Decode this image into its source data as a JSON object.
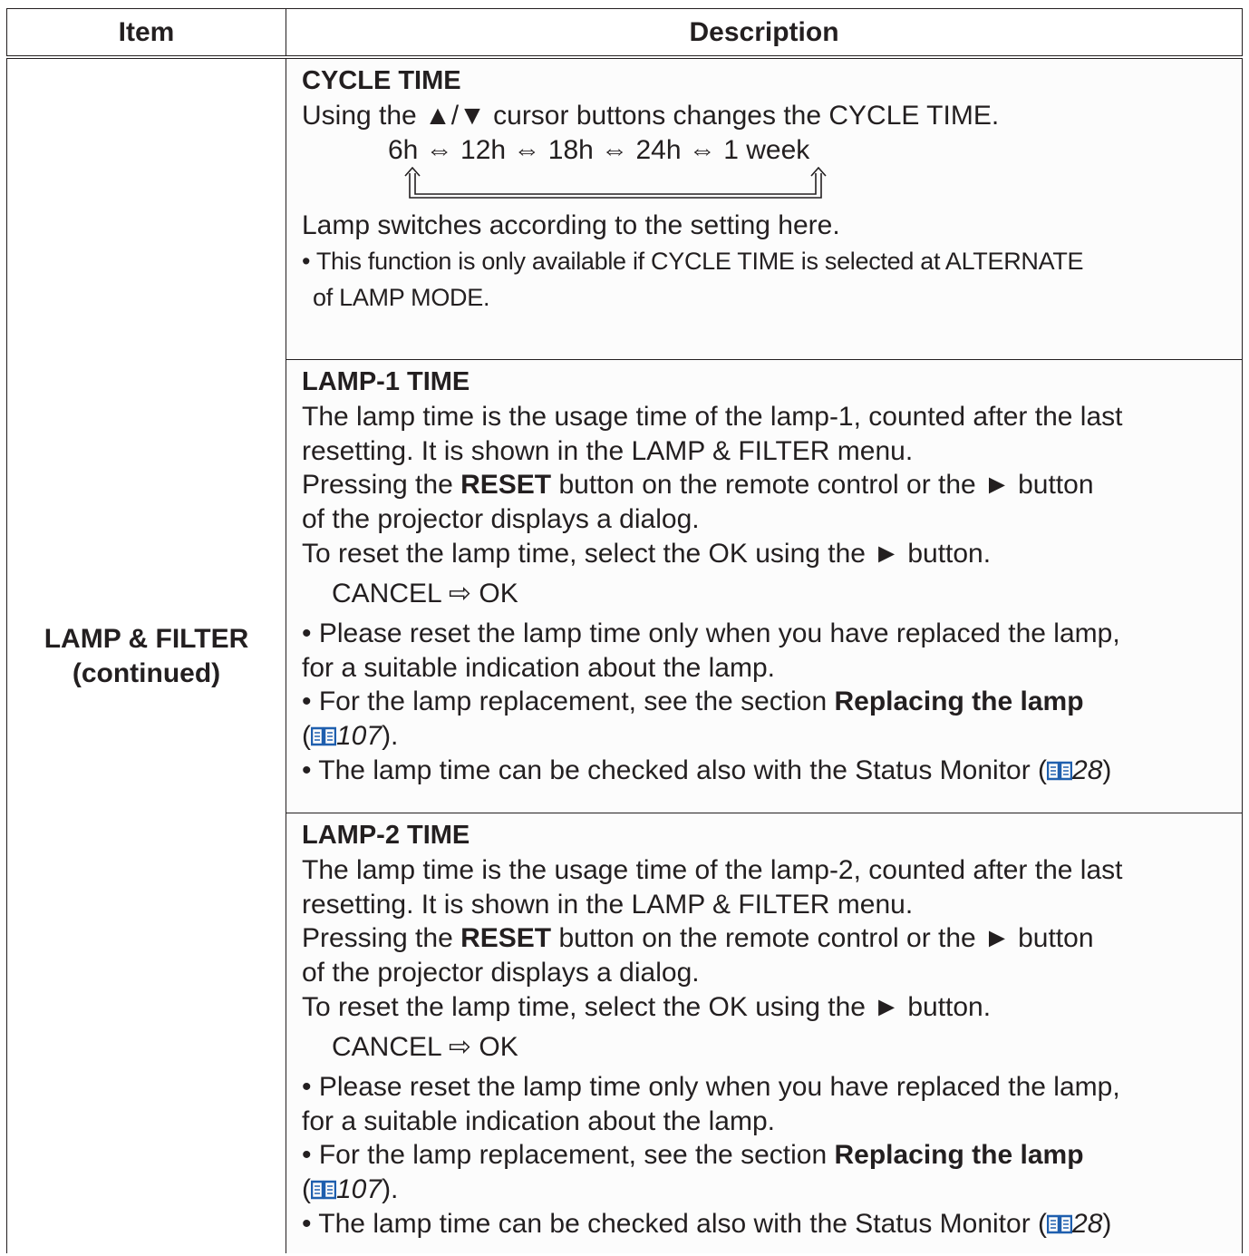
{
  "header": {
    "item": "Item",
    "description": "Description"
  },
  "item_label": {
    "line1": "LAMP & FILTER",
    "line2": "(continued)"
  },
  "cycle_time": {
    "title": "CYCLE TIME",
    "line1": "Using the ▲/▼ cursor buttons changes the CYCLE TIME.",
    "sequence": "6h ⇔ 12h ⇔ 18h ⇔ 24h ⇔ 1 week",
    "line2": "Lamp switches according to the setting here.",
    "note1": "• This function is only available if CYCLE TIME is selected at ALTERNATE",
    "note2": "of LAMP MODE."
  },
  "lamp1": {
    "title": "LAMP-1 TIME",
    "l1": "The lamp time is the usage time of the lamp-1, counted after the last",
    "l2": "resetting. It is shown in the LAMP & FILTER menu.",
    "l3_a": "Pressing the ",
    "l3_b": "RESET",
    "l3_c": " button on the remote control or the ► button",
    "l4": "of the projector displays a dialog.",
    "l5": "To reset the lamp time, select the OK using the ► button.",
    "dialog": "CANCEL ⇨ OK",
    "b1a": "• Please reset the lamp time only when you have replaced the lamp,",
    "b1b": "for a suitable indication about the lamp.",
    "b2a": "• For the lamp replacement, see the section ",
    "b2b": "Replacing the lamp",
    "b2c_open": "(",
    "b2c_ref": "107",
    "b2c_close": ").",
    "b3a": "• The lamp time can be checked also with the Status Monitor (",
    "b3_ref": "28",
    "b3_close": ")"
  },
  "lamp2": {
    "title": "LAMP-2 TIME",
    "l1": "The lamp time is the usage time of the lamp-2, counted after the last",
    "l2": "resetting. It is shown in the LAMP & FILTER menu.",
    "l3_a": "Pressing the ",
    "l3_b": "RESET",
    "l3_c": " button on the remote control or the ► button",
    "l4": "of the projector displays a dialog.",
    "l5": "To reset the lamp time, select the OK using the ► button.",
    "dialog": "CANCEL ⇨ OK",
    "b1a": "• Please reset the lamp time only when you have replaced the lamp,",
    "b1b": "for a suitable indication about the lamp.",
    "b2a": "• For the lamp replacement, see the section ",
    "b2b": "Replacing the lamp",
    "b2c_open": "(",
    "b2c_ref": "107",
    "b2c_close": ").",
    "b3a": "• The lamp time can be checked also with the Status Monitor (",
    "b3_ref": "28",
    "b3_close": ")"
  },
  "icons": {
    "reference": "book-icon",
    "accent": "#1f5fae"
  }
}
